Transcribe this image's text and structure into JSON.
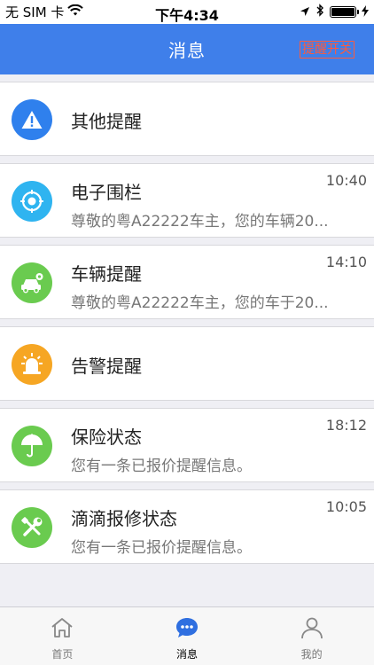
{
  "status_bar": {
    "carrier": "无 SIM 卡",
    "time": "下午4:34"
  },
  "nav": {
    "title": "消息",
    "action_label": "提醒开关"
  },
  "colors": {
    "nav_bg": "#3f7fea",
    "action": "#ff5a3c",
    "icon_blue": "#2f80ed",
    "icon_teal": "#2fb4f0",
    "icon_green": "#6acb4f",
    "icon_orange": "#f6a623",
    "tab_active": "#2f6fe0"
  },
  "messages": [
    {
      "title": "其他提醒",
      "subtitle": "",
      "time": "",
      "icon": "warning-icon"
    },
    {
      "title": "电子围栏",
      "subtitle": "尊敬的粤A22222车主，您的车辆20...",
      "time": "10:40",
      "icon": "geofence-icon"
    },
    {
      "title": "车辆提醒",
      "subtitle": "尊敬的粤A22222车主，您的车于20...",
      "time": "14:10",
      "icon": "car-icon"
    },
    {
      "title": "告警提醒",
      "subtitle": "",
      "time": "",
      "icon": "alarm-light-icon"
    },
    {
      "title": "保险状态",
      "subtitle": "您有一条已报价提醒信息。",
      "time": "18:12",
      "icon": "umbrella-icon"
    },
    {
      "title": "滴滴报修状态",
      "subtitle": "您有一条已报价提醒信息。",
      "time": "10:05",
      "icon": "repair-tools-icon"
    }
  ],
  "tabs": [
    {
      "label": "首页",
      "icon": "home-icon",
      "active": false
    },
    {
      "label": "消息",
      "icon": "chat-icon",
      "active": true
    },
    {
      "label": "我的",
      "icon": "user-icon",
      "active": false
    }
  ]
}
